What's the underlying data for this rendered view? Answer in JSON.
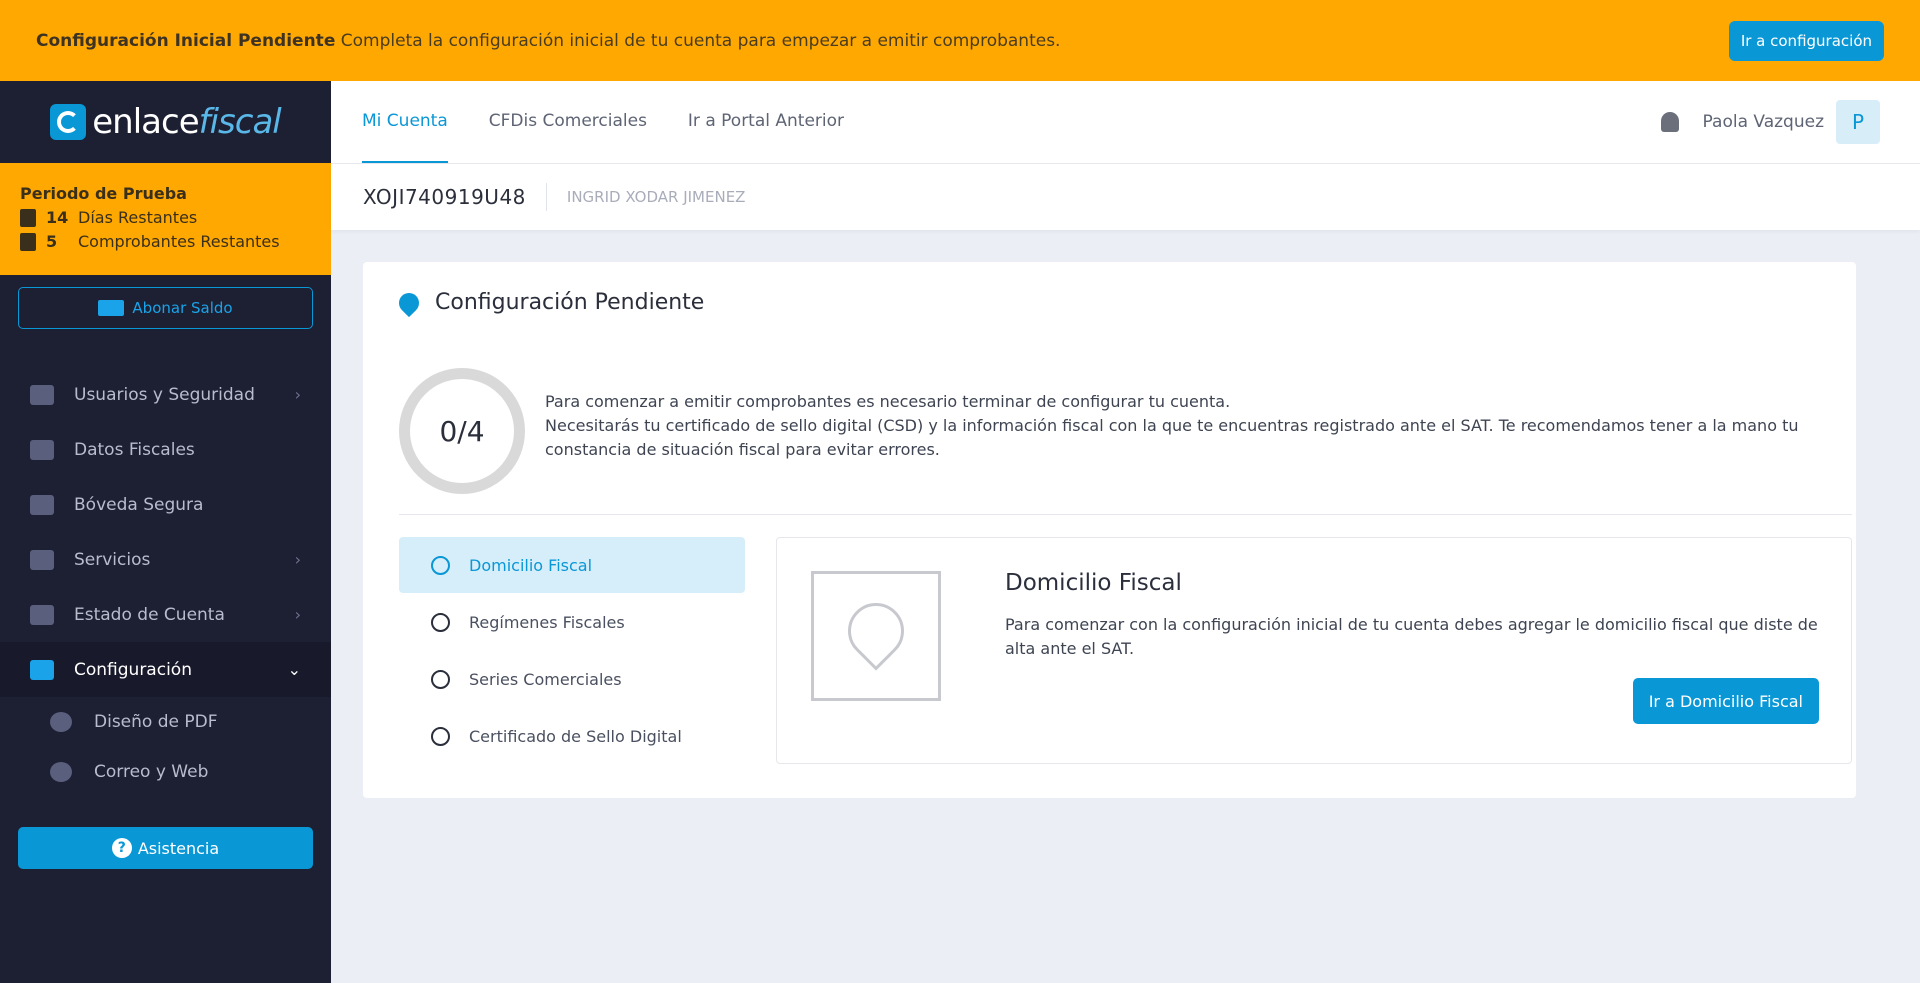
{
  "banner": {
    "title": "Configuración Inicial Pendiente",
    "message": "Completa la configuración inicial de tu cuenta para empezar a emitir comprobantes.",
    "button": "Ir a configuración"
  },
  "logo": {
    "part1": "enlace",
    "part2": "fiscal"
  },
  "trial": {
    "title": "Periodo de Prueba",
    "days_num": "14",
    "days_label": "Días Restantes",
    "comp_num": "5",
    "comp_label": "Comprobantes Restantes"
  },
  "sidebar": {
    "abonar": "Abonar Saldo",
    "items": [
      {
        "label": "Usuarios y Seguridad",
        "chevron": "›"
      },
      {
        "label": "Datos Fiscales",
        "chevron": ""
      },
      {
        "label": "Bóveda Segura",
        "chevron": ""
      },
      {
        "label": "Servicios",
        "chevron": "›"
      },
      {
        "label": "Estado de Cuenta",
        "chevron": "›"
      },
      {
        "label": "Configuración",
        "chevron": "⌄"
      }
    ],
    "subitems": [
      {
        "label": "Diseño de PDF"
      },
      {
        "label": "Correo y Web"
      }
    ],
    "asistencia": "Asistencia",
    "asistencia_icon": "?"
  },
  "topnav": {
    "tabs": [
      {
        "label": "Mi Cuenta"
      },
      {
        "label": "CFDis Comerciales"
      },
      {
        "label": "Ir a Portal Anterior"
      }
    ],
    "user_name": "Paola Vazquez",
    "avatar_letter": "P"
  },
  "rfcbar": {
    "rfc": "XOJI740919U48",
    "razon": "INGRID XODAR JIMENEZ"
  },
  "card": {
    "title": "Configuración Pendiente",
    "progress": "0/4",
    "intro_line1": "Para comenzar a emitir comprobantes es necesario terminar de configurar tu cuenta.",
    "intro_line2": "Necesitarás tu certificado de sello digital (CSD) y la información fiscal con la que te encuentras registrado ante el SAT. Te recomendamos tener a la mano tu constancia de situación fiscal para evitar errores.",
    "steps": [
      {
        "label": "Domicilio Fiscal"
      },
      {
        "label": "Regímenes Fiscales"
      },
      {
        "label": "Series Comerciales"
      },
      {
        "label": "Certificado de Sello Digital"
      }
    ],
    "detail_title": "Domicilio Fiscal",
    "detail_text": "Para comenzar con la configuración inicial de tu cuenta debes agregar le domicilio fiscal que diste de alta ante el SAT.",
    "detail_button": "Ir a Domicilio Fiscal"
  },
  "colors": {
    "accent": "#0a97d6",
    "warning": "#ffa801",
    "sidebar": "#1d1f33"
  }
}
